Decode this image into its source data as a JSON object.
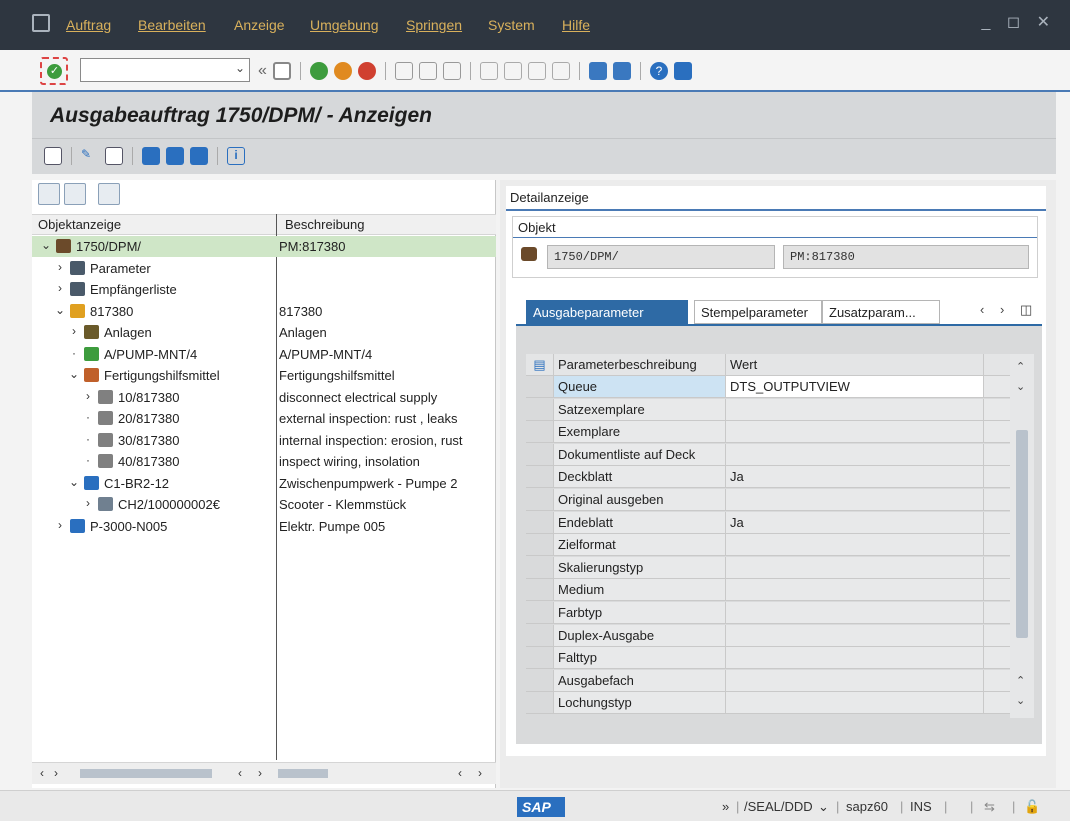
{
  "menu": {
    "items": [
      "Auftrag",
      "Bearbeiten",
      "Anzeige",
      "Umgebung",
      "Springen",
      "System",
      "Hilfe"
    ]
  },
  "window_controls": "_ ◻ ✕",
  "command_field": {
    "value": ""
  },
  "title": "Ausgabeauftrag 1750/DPM/ - Anzeigen",
  "tree": {
    "col_object": "Objektanzeige",
    "col_desc": "Beschreibung",
    "rows": [
      {
        "exp": "⌄",
        "name": "1750/DPM/",
        "desc": "PM:817380",
        "icon": "printer-icon",
        "color": "#6b4a2a"
      },
      {
        "exp": "›",
        "name": "Parameter",
        "desc": "",
        "icon": "parameter-icon",
        "color": "#4a5a6a"
      },
      {
        "exp": "›",
        "name": "Empfängerliste",
        "desc": "",
        "icon": "recipients-icon",
        "color": "#4a5a6a"
      },
      {
        "exp": "⌄",
        "name": "817380",
        "desc": "817380",
        "icon": "order-icon",
        "color": "#e0a020"
      },
      {
        "exp": "›",
        "name": "Anlagen",
        "desc": "Anlagen",
        "icon": "attachments-icon",
        "color": "#6a5a2a"
      },
      {
        "exp": "·",
        "name": "A/PUMP-MNT/4",
        "desc": "A/PUMP-MNT/4",
        "icon": "location-icon",
        "color": "#3d9c3d"
      },
      {
        "exp": "⌄",
        "name": "Fertigungshilfsmittel",
        "desc": "Fertigungshilfsmittel",
        "icon": "tools-icon",
        "color": "#c0602a"
      },
      {
        "exp": "›",
        "name": "10/817380",
        "desc": "disconnect electrical supply",
        "icon": "operation-icon",
        "color": "#808080"
      },
      {
        "exp": "·",
        "name": "20/817380",
        "desc": "external inspection: rust , leaks",
        "icon": "operation-icon",
        "color": "#808080"
      },
      {
        "exp": "·",
        "name": "30/817380",
        "desc": "internal inspection: erosion, rust",
        "icon": "operation-icon",
        "color": "#808080"
      },
      {
        "exp": "·",
        "name": "40/817380",
        "desc": "inspect wiring, insolation",
        "icon": "operation-icon",
        "color": "#808080"
      },
      {
        "exp": "⌄",
        "name": "C1-BR2-12",
        "desc": "Zwischenpumpwerk - Pumpe 2",
        "icon": "equipment-icon",
        "color": "#2a6fbf"
      },
      {
        "exp": "›",
        "name": "CH2/100000002€",
        "desc": "Scooter - Klemmstück",
        "icon": "material-icon",
        "color": "#708090"
      },
      {
        "exp": "›",
        "name": "P-3000-N005",
        "desc": "Elektr. Pumpe 005",
        "icon": "equipment-icon",
        "color": "#2a6fbf"
      }
    ]
  },
  "detail": {
    "header": "Detailanzeige",
    "object_label": "Objekt",
    "object_id": "1750/DPM/",
    "object_desc": "PM:817380",
    "tabs": [
      "Ausgabeparameter",
      "Stempelparameter",
      "Zusatzparam..."
    ],
    "grid": {
      "col_param": "Parameterbeschreibung",
      "col_value": "Wert",
      "rows": [
        {
          "param": "Queue",
          "value": "DTS_OUTPUTVIEW"
        },
        {
          "param": "Satzexemplare",
          "value": ""
        },
        {
          "param": "Exemplare",
          "value": ""
        },
        {
          "param": "Dokumentliste auf Deck",
          "value": ""
        },
        {
          "param": "Deckblatt",
          "value": "Ja"
        },
        {
          "param": "Original ausgeben",
          "value": ""
        },
        {
          "param": "Endeblatt",
          "value": "Ja"
        },
        {
          "param": "Zielformat",
          "value": ""
        },
        {
          "param": "Skalierungstyp",
          "value": ""
        },
        {
          "param": "Medium",
          "value": ""
        },
        {
          "param": "Farbtyp",
          "value": ""
        },
        {
          "param": "Duplex-Ausgabe",
          "value": ""
        },
        {
          "param": "Falttyp",
          "value": ""
        },
        {
          "param": "Ausgabefach",
          "value": ""
        },
        {
          "param": "Lochungstyp",
          "value": ""
        }
      ]
    }
  },
  "status": {
    "logo": "SAP",
    "arrows": "»",
    "system": "/SEAL/DDD",
    "server": "sapz60",
    "mode": "INS"
  }
}
